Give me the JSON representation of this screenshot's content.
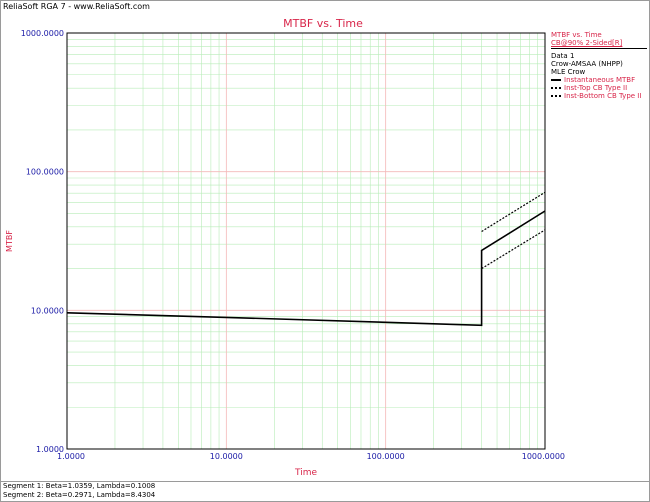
{
  "header": {
    "app_title": "ReliaSoft RGA 7 - www.ReliaSoft.com"
  },
  "legend": {
    "title": "MTBF vs. Time",
    "subtitle": "CB@90% 2-Sided[R]",
    "data_name": "Data 1",
    "model": "Crow-AMSAA (NHPP)",
    "method": "MLE Crow",
    "entries": [
      "Instantaneous MTBF",
      "Inst-Top CB Type II",
      "Inst-Bottom CB Type II"
    ]
  },
  "footer": {
    "segment1": "Segment 1: Beta=1.0359, Lambda=0.1008",
    "segment2": "Segment 2: Beta=0.2971, Lambda=8.4304"
  },
  "colors": {
    "accent_red": "#d8264a",
    "tick_blue": "#1a1aa6",
    "grid_major": "#f4b8b8",
    "grid_minor": "#b8ecb8",
    "curve": "#000000"
  },
  "chart_data": {
    "type": "line",
    "title": "MTBF vs. Time",
    "xlabel": "Time",
    "ylabel": "MTBF",
    "x_scale": "log",
    "y_scale": "log",
    "xlim": [
      1,
      1000
    ],
    "ylim": [
      1,
      1000
    ],
    "xticks": [
      "1.0000",
      "10.0000",
      "100.0000",
      "1000.0000"
    ],
    "yticks": [
      "1.0000",
      "10.0000",
      "100.0000",
      "1000.0000"
    ],
    "grid": true,
    "legend_position": "right",
    "series": [
      {
        "name": "Instantaneous MTBF",
        "style": "solid",
        "x": [
          1,
          10,
          100,
          400,
          400,
          1000
        ],
        "y": [
          9.6,
          8.9,
          8.2,
          7.8,
          27,
          52
        ]
      },
      {
        "name": "Inst-Top CB Type II",
        "style": "dotted",
        "x": [
          400,
          1000
        ],
        "y": [
          37,
          71
        ]
      },
      {
        "name": "Inst-Bottom CB Type II",
        "style": "dotted",
        "x": [
          400,
          1000
        ],
        "y": [
          20,
          38
        ]
      }
    ]
  }
}
